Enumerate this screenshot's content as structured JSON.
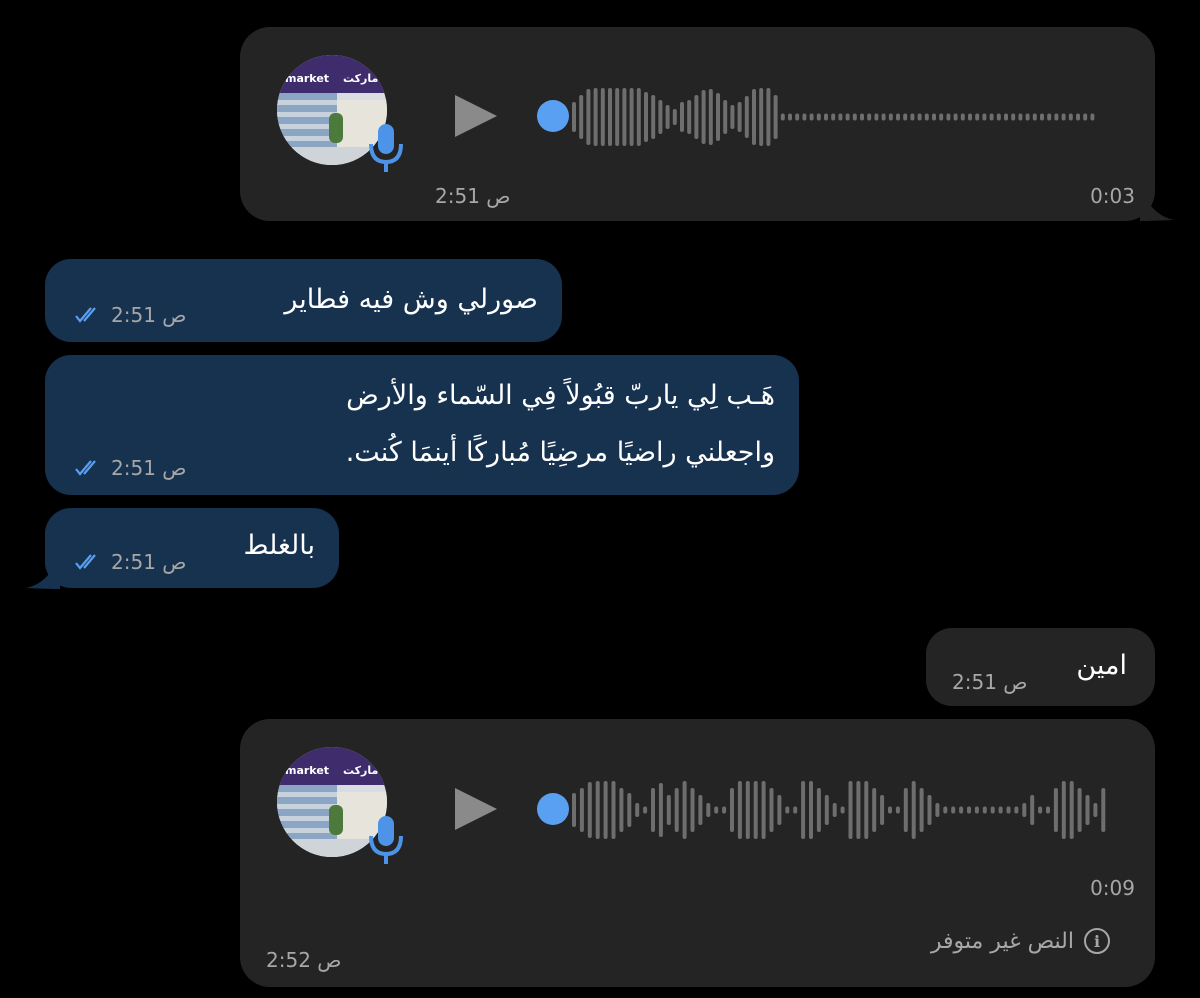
{
  "messages": [
    {
      "type": "voice",
      "direction": "in",
      "duration": "0:03",
      "time": "2:51 ص"
    },
    {
      "type": "text",
      "direction": "out",
      "text": "صورلي وش فيه فطاير",
      "time": "2:51 ص",
      "status": "read"
    },
    {
      "type": "text",
      "direction": "out",
      "lines": [
        "هَـب لِي ياربّ قبُولاً فِي السّماء والأرض",
        "واجعلني راضيًا مرضِيًا مُباركًا أينمَا كُنت."
      ],
      "time": "2:51 ص",
      "status": "read"
    },
    {
      "type": "text",
      "direction": "out",
      "text": "بالغلط",
      "time": "2:51 ص",
      "status": "read"
    },
    {
      "type": "text",
      "direction": "in",
      "text": "امين",
      "time": "2:51 ص"
    },
    {
      "type": "voice",
      "direction": "in",
      "duration": "0:09",
      "time": "2:52 ص",
      "transcript": "النص غير متوفر"
    }
  ],
  "avatar": {
    "sign_ar": "ماركت",
    "sign_en": "market"
  },
  "colors": {
    "accent": "#5aa0f2",
    "bubble_in": "#242424",
    "bubble_out": "#16324f",
    "background": "#000000"
  },
  "icons": [
    "play-icon",
    "mic-icon",
    "read-ticks-icon",
    "info-icon"
  ]
}
